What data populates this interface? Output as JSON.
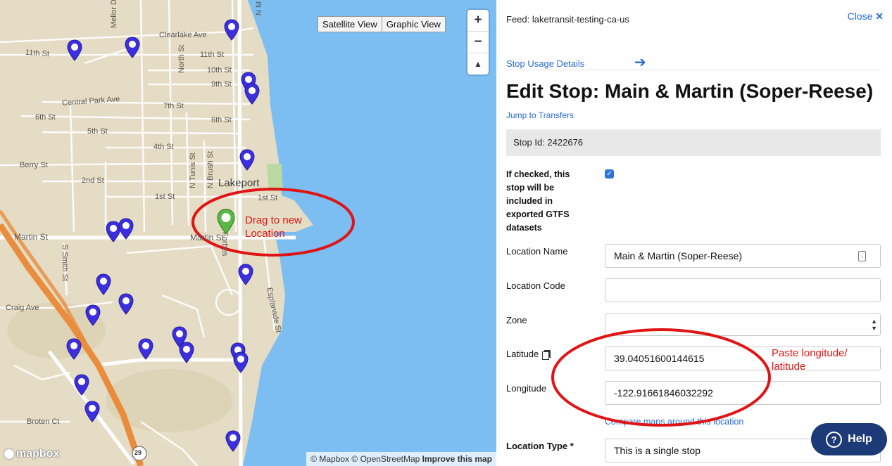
{
  "map": {
    "view_buttons": [
      "Satellite View",
      "Graphic View"
    ],
    "zoom_in": "+",
    "zoom_out": "−",
    "compass": "▲",
    "logo_text": "mapbox",
    "attribution": "© Mapbox © OpenStreetMap",
    "improve": "Improve this map",
    "place_label": "Lakeport",
    "highway_shield": "29",
    "street_labels": {
      "eleventh_a": "11th St",
      "eleventh_b": "11th St",
      "tenth": "10th St",
      "ninth": "9th St",
      "eighth": "8th St",
      "seventh": "7th St",
      "sixth_a": "6th St",
      "sixth_b": "6th St",
      "fifth": "5th St",
      "fourth": "4th St",
      "third": "3rd St",
      "second": "2nd St",
      "first_a": "1st St",
      "first_b": "1st St",
      "martin_a": "Martin St",
      "martin_b": "Martin St",
      "berry": "Berry St",
      "craig": "Craig Ave",
      "broten": "Broten Ct",
      "clearlake": "Clearlake Ave",
      "central_park": "Central Park Ave",
      "mellor": "Mellor Dr",
      "north": "North St",
      "n_tunis": "N Tunis St",
      "n_brush": "N Brush St",
      "forbes": "Forbes",
      "esplanade": "Esplanade St",
      "s_smith": "S Smith St",
      "n_m": "N M"
    },
    "annotation_drag": "Drag to new Location",
    "accent_pin": "#3b2fe0",
    "selected_pin": "#5bb845",
    "annotation_color": "#e01414",
    "water_color": "#7cbdf2"
  },
  "panel": {
    "feed": "Feed: laketransit-testing-ca-us",
    "close_label": "Close",
    "close_icon": "✕",
    "usage_link": "Stop Usage Details",
    "usage_arrow": "➔",
    "title": "Edit Stop: Main & Martin (Soper-Reese)",
    "jump_link": "Jump to Transfers",
    "stop_id": "Stop Id: 2422676",
    "checkbox_label": "If checked, this stop will be included in exported GTFS datasets",
    "checkbox_checked": true,
    "location_name_label": "Location Name",
    "location_name_value": "Main & Martin (Soper-Reese)",
    "location_code_label": "Location Code",
    "location_code_value": "",
    "zone_label": "Zone",
    "zone_value": "",
    "latitude_label": "Latitude",
    "latitude_value": "39.04051600144615",
    "longitude_label": "Longitude",
    "longitude_value": "-122.91661846032292",
    "compare_link": "Compare maps around this location",
    "location_type_label": "Location Type *",
    "location_type_value": "This is a single stop",
    "annotation_paste": "Paste longitude/ latitude",
    "help_label": "Help",
    "help_icon": "?",
    "link_color": "#2a6ad6",
    "help_bg": "#1c3a77"
  }
}
